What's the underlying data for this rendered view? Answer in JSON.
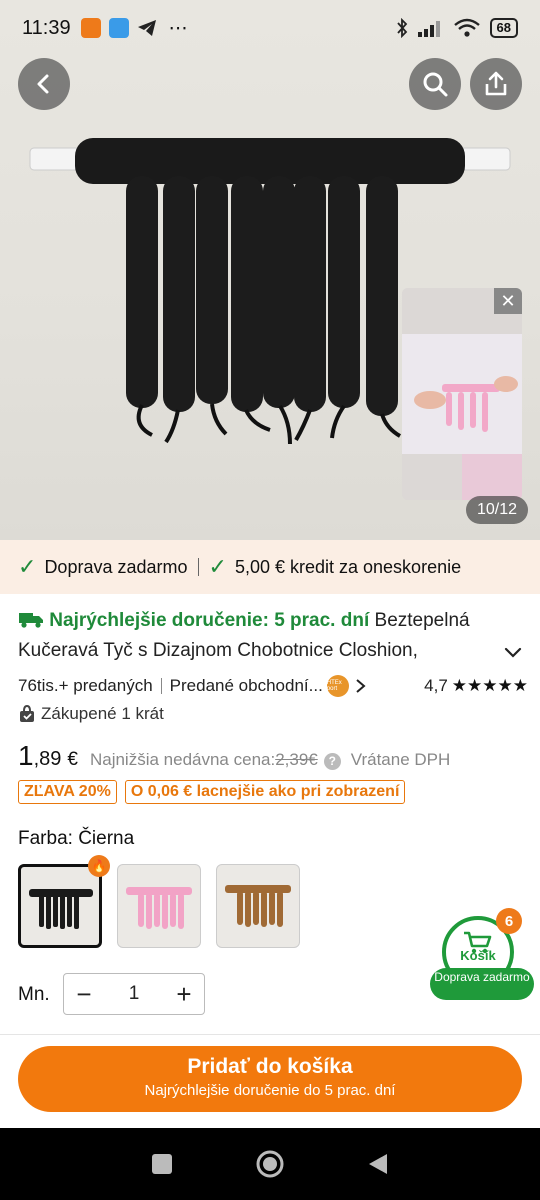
{
  "status": {
    "time": "11:39",
    "battery": "68",
    "more": "⋯"
  },
  "hero": {
    "counter": "10/12"
  },
  "promo": {
    "free_shipping": "Doprava zadarmo",
    "credit": "5,00 € kredit za oneskorenie"
  },
  "product": {
    "fast_delivery": "Najrýchlejšie doručenie: 5 prac. dní",
    "title_part1": "Beztepelná",
    "title_part2": "Kučeravá Tyč s Dizajnom Chobotnice Closhion,",
    "sold": "76tis.+ predaných",
    "seller": "Predané obchodní...",
    "seller_badge": "HTEx port",
    "rating": "4,7",
    "bought": "Zákupené 1 krát"
  },
  "price": {
    "integer": "1",
    "decimal": ",89",
    "currency": "€",
    "lowest_label": "Najnižšia nedávna cena:",
    "old_price": "2,39€",
    "vat": "Vrátane DPH",
    "discount_tag": "ZĽAVA 20%",
    "cheaper_tag": "O 0,06 € lacnejšie ako pri zobrazení"
  },
  "color": {
    "label": "Farba: Čierna",
    "options": [
      "black",
      "pink",
      "brown"
    ]
  },
  "cart": {
    "count": "6",
    "label": "Košík",
    "ship": "Doprava zadarmo"
  },
  "quantity": {
    "label": "Mn.",
    "value": "1",
    "minus": "−",
    "plus": "+"
  },
  "add_button": {
    "label": "Pridať do košíka",
    "sub": "Najrýchlejšie doručenie do 5 prac. dní"
  },
  "colors": {
    "accent": "#f2790d",
    "green": "#1f9a3a",
    "promo_bg": "#fbeee4"
  }
}
